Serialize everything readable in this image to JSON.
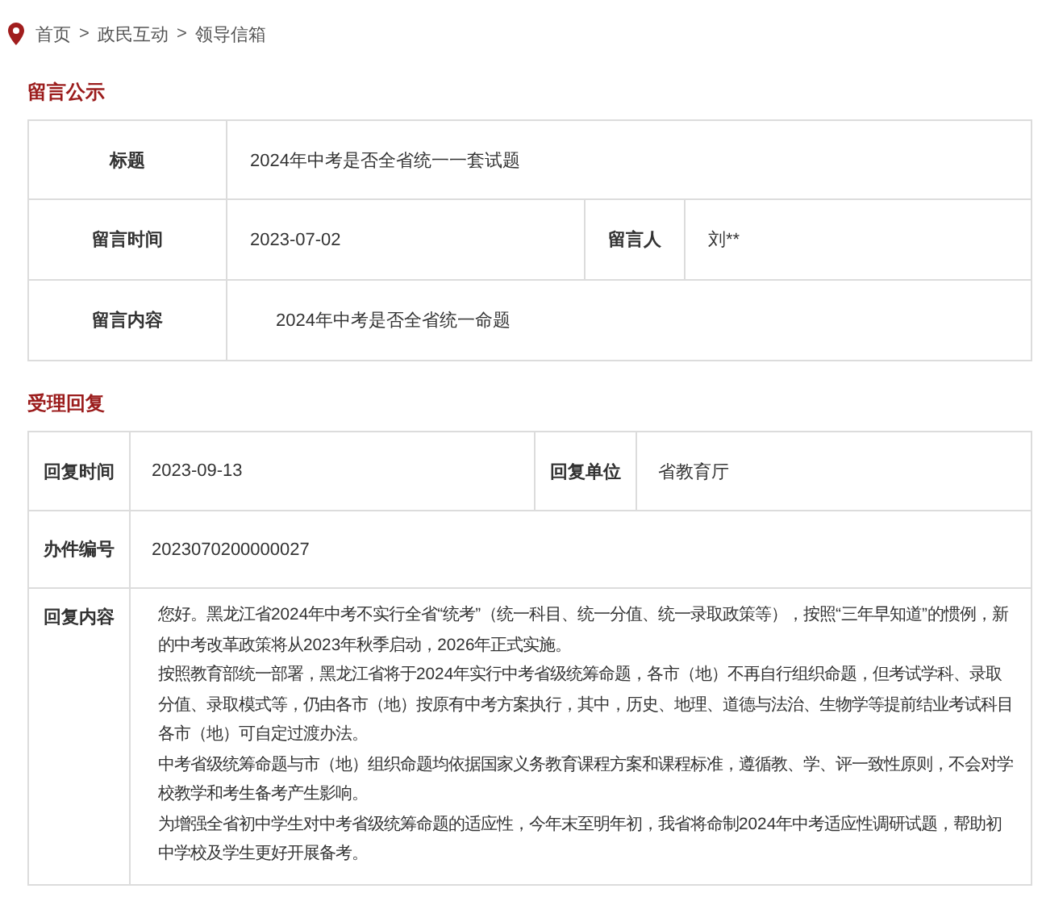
{
  "breadcrumb": {
    "links": [
      "首页",
      "政民互动",
      "领导信箱"
    ],
    "separators": [
      ">",
      ">"
    ]
  },
  "sections": [
    {
      "title": "留言公示",
      "rows": [
        {
          "cells": [
            {
              "kind": "label",
              "text": "标题"
            },
            {
              "kind": "value",
              "text": "2024年中考是否全省统一一套试题"
            }
          ]
        },
        {
          "cells": [
            {
              "kind": "label",
              "text": "留言时间"
            },
            {
              "kind": "value",
              "text": "2023-07-02"
            },
            {
              "kind": "label",
              "text": "留言人"
            },
            {
              "kind": "value",
              "text": "刘**"
            }
          ]
        },
        {
          "cells": [
            {
              "kind": "label",
              "text": "留言内容"
            },
            {
              "kind": "value",
              "text": "2024年中考是否全省统一命题"
            }
          ]
        }
      ]
    },
    {
      "title": "受理回复",
      "rows": [
        {
          "cells": [
            {
              "kind": "label",
              "text": "回复时间"
            },
            {
              "kind": "value",
              "text": "2023-09-13"
            },
            {
              "kind": "label",
              "text": "回复单位"
            },
            {
              "kind": "value",
              "text": "省教育厅"
            }
          ]
        },
        {
          "cells": [
            {
              "kind": "label",
              "text": "办件编号"
            },
            {
              "kind": "value",
              "text": "2023070200000027"
            }
          ]
        },
        {
          "cells": [
            {
              "kind": "label",
              "text": "回复内容"
            },
            {
              "kind": "paragraphs",
              "paragraphs": [
                "您好。黑龙江省2024年中考不实行全省“统考”（统一科目、统一分值、统一录取政策等），按照“三年早知道”的惯例，新的中考改革政策将从2023年秋季启动，2026年正式实施。",
                "按照教育部统一部署，黑龙江省将于2024年实行中考省级统筹命题，各市（地）不再自行组织命题，但考试学科、录取分值、录取模式等，仍由各市（地）按原有中考方案执行，其中，历史、地理、道德与法治、生物学等提前结业考试科目各市（地）可自定过渡办法。",
                "中考省级统筹命题与市（地）组织命题均依据国家义务教育课程方案和课程标准，遵循教、学、评一致性原则，不会对学校教学和考生备考产生影响。",
                "为增强全省初中学生对中考省级统筹命题的适应性，今年末至明年初，我省将命制2024年中考适应性调研试题，帮助初中学校及学生更好开展备考。"
              ]
            }
          ]
        }
      ]
    }
  ]
}
